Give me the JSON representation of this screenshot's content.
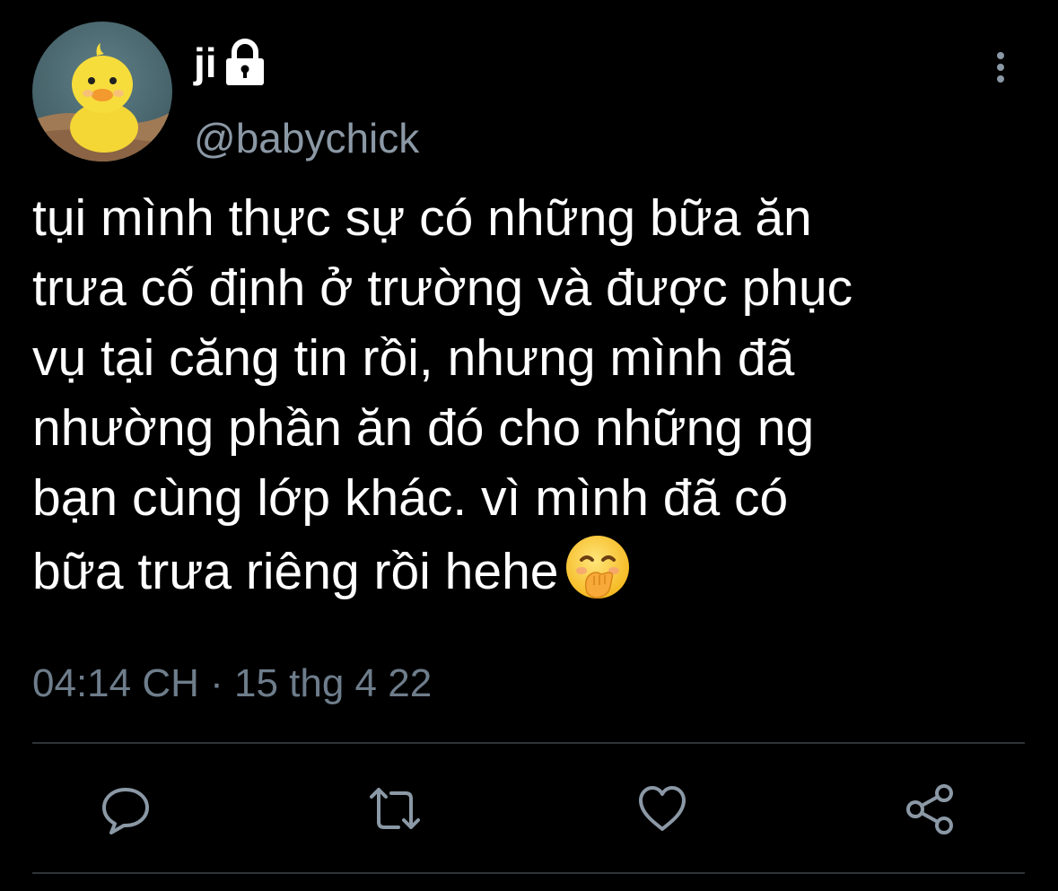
{
  "tweet": {
    "author": {
      "display_name": "ji",
      "handle": "@babychick",
      "protected_icon": "lock-icon",
      "avatar": "yellow duck plush"
    },
    "menu_icon": "more-vertical-icon",
    "text": "tụi mình thực sự có những bữa ăn\ntrưa cố định ở trường và được phục\nvụ tại căng tin rồi, nhưng mình đã\nnhường phần ăn đó cho những ng\nbạn cùng lớp khác. vì mình đã có\nbữa trưa riêng rồi hehe",
    "emoji": "face-with-hand-over-mouth",
    "timestamp": "04:14 CH · 15 thg 4 22"
  },
  "actions": [
    {
      "name": "reply",
      "icon": "reply-icon"
    },
    {
      "name": "retweet",
      "icon": "retweet-icon"
    },
    {
      "name": "like",
      "icon": "heart-icon"
    },
    {
      "name": "share",
      "icon": "share-icon"
    }
  ],
  "colors": {
    "background": "#000000",
    "text_primary": "#ffffff",
    "text_secondary": "#8b98a5",
    "icon": "#8b98a5",
    "divider": "#2f3336"
  }
}
